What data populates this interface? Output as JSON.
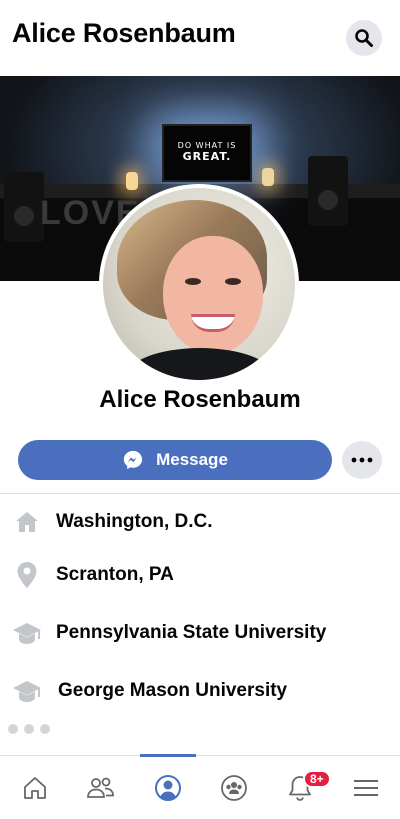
{
  "header": {
    "title": "Alice Rosenbaum",
    "search_icon": "search-icon"
  },
  "cover": {
    "monitor_line1": "DO WHAT IS",
    "monitor_line2": "GREAT.",
    "word_sign": "LOVE"
  },
  "profile": {
    "name": "Alice Rosenbaum"
  },
  "actions": {
    "message_label": "Message",
    "message_icon": "messenger-icon",
    "more_icon": "more-horizontal-icon",
    "accent_color": "#4a6fbf"
  },
  "details": [
    {
      "icon": "home-icon",
      "label": "Washington, D.C."
    },
    {
      "icon": "location-pin-icon",
      "label": "Scranton, PA"
    },
    {
      "icon": "graduation-cap-icon",
      "label": "Pennsylvania State University"
    },
    {
      "icon": "graduation-cap-icon",
      "label": "George Mason University"
    }
  ],
  "bottom_nav": {
    "items": [
      {
        "icon": "home-icon",
        "active": false
      },
      {
        "icon": "friends-icon",
        "active": false
      },
      {
        "icon": "profile-icon",
        "active": true
      },
      {
        "icon": "groups-icon",
        "active": false
      },
      {
        "icon": "bell-icon",
        "active": false,
        "badge": "8+"
      },
      {
        "icon": "menu-icon",
        "active": false
      }
    ],
    "badge_color": "#e41e3f"
  }
}
